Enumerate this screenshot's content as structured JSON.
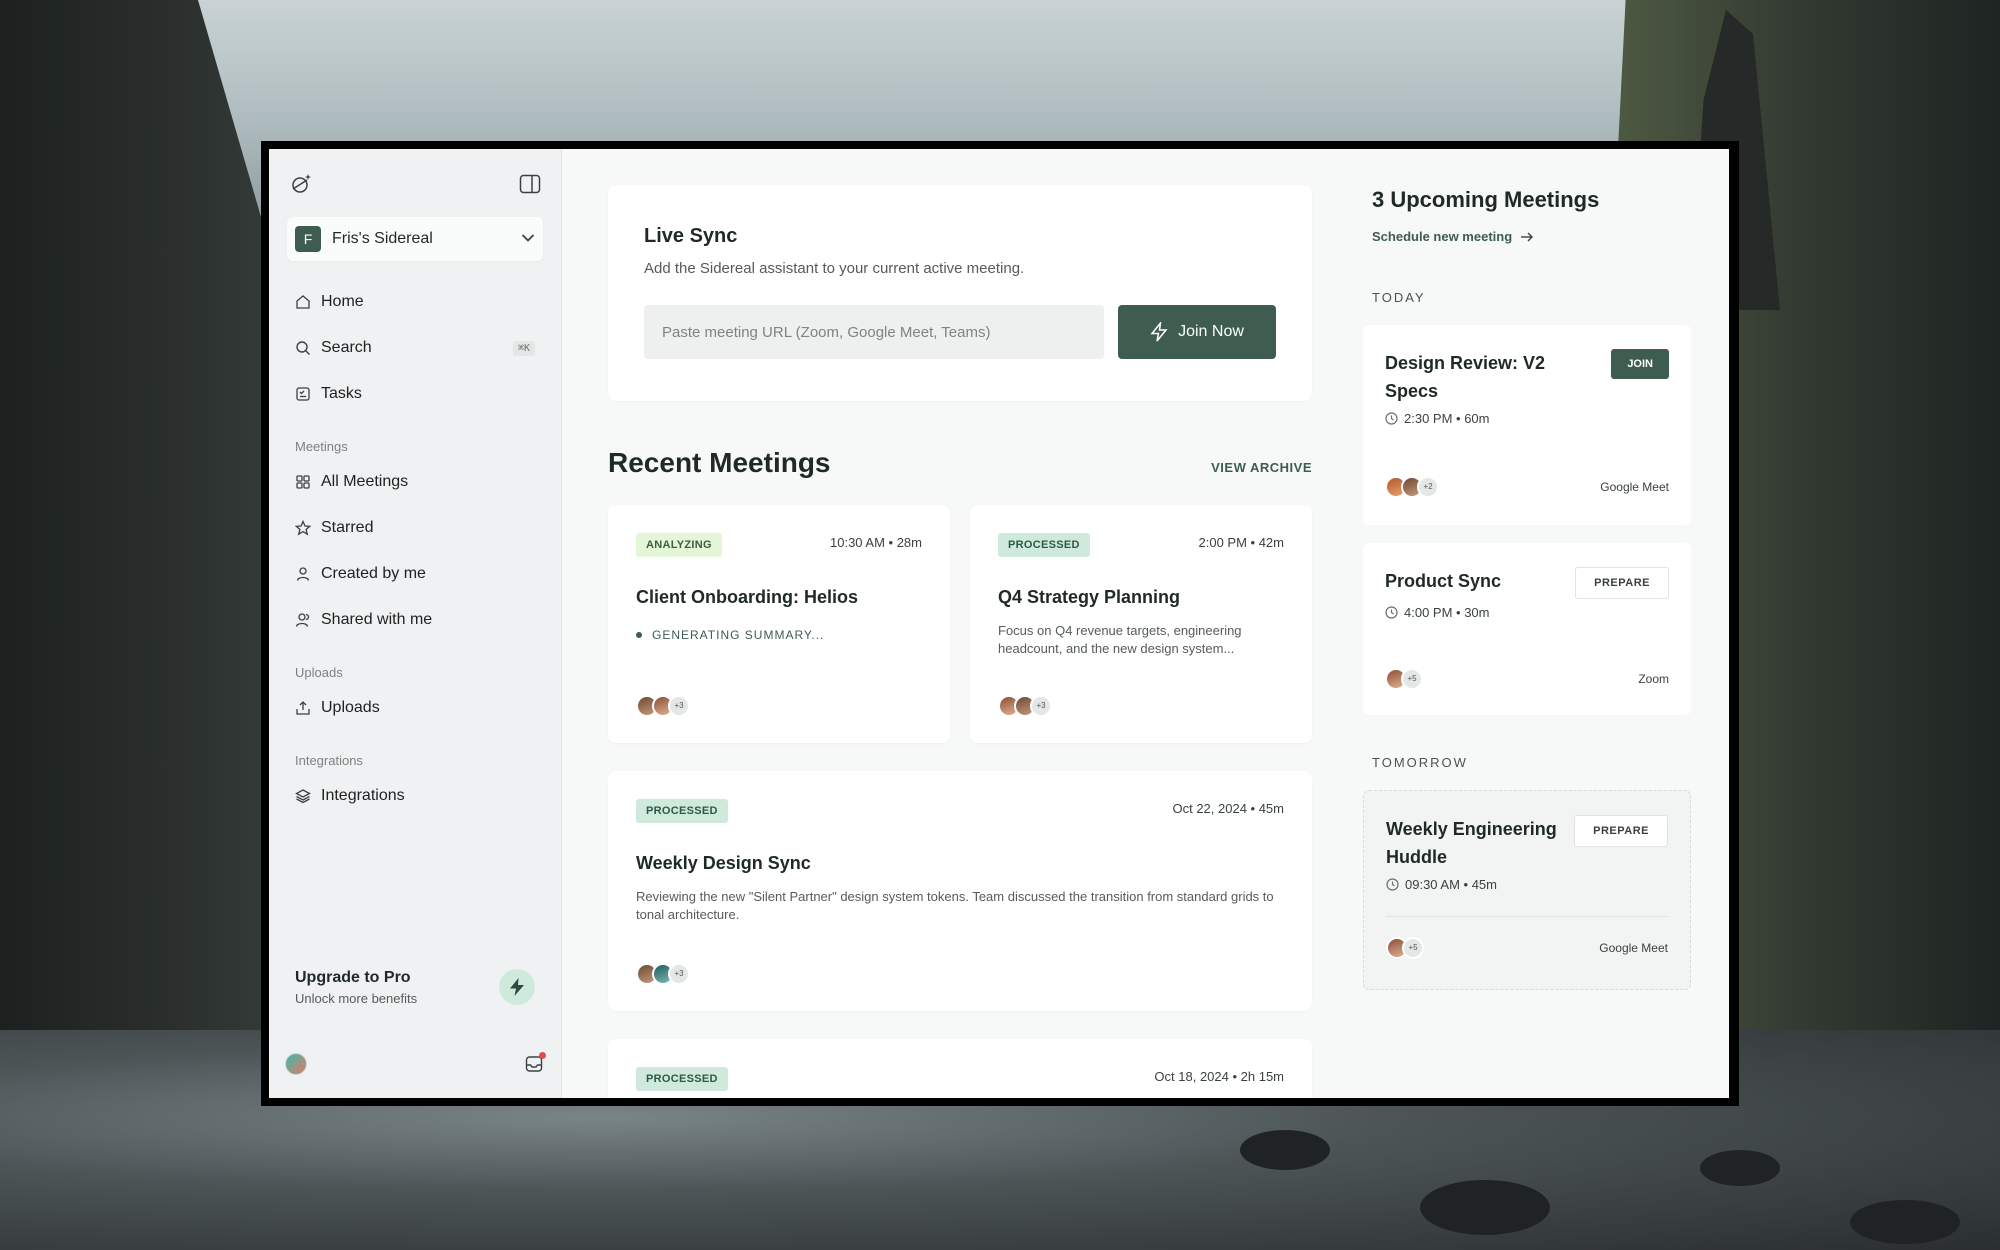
{
  "workspace": {
    "initial": "F",
    "name": "Fris's Sidereal"
  },
  "nav": {
    "home": "Home",
    "search": "Search",
    "search_shortcut": "⌘K",
    "tasks": "Tasks"
  },
  "sections": {
    "meetings": {
      "label": "Meetings",
      "items": [
        "All Meetings",
        "Starred",
        "Created by me",
        "Shared with me"
      ]
    },
    "uploads": {
      "label": "Uploads",
      "items": [
        "Uploads"
      ]
    },
    "integrations": {
      "label": "Integrations",
      "items": [
        "Integrations"
      ]
    }
  },
  "upgrade": {
    "title": "Upgrade to Pro",
    "subtitle": "Unlock more benefits"
  },
  "live_sync": {
    "title": "Live Sync",
    "subtitle": "Add the Sidereal assistant to your current active meeting.",
    "placeholder": "Paste meeting URL (Zoom, Google Meet, Teams)",
    "button": "Join Now"
  },
  "recent": {
    "title": "Recent Meetings",
    "archive": "VIEW ARCHIVE",
    "cards": [
      {
        "status": "ANALYZING",
        "time": "10:30 AM • 28m",
        "title": "Client Onboarding: Helios",
        "note": "GENERATING SUMMARY...",
        "more": "+3"
      },
      {
        "status": "PROCESSED",
        "time": "2:00 PM • 42m",
        "title": "Q4 Strategy Planning",
        "desc": "Focus on Q4 revenue targets, engineering headcount, and the new design system...",
        "more": "+3"
      },
      {
        "status": "PROCESSED",
        "time": "Oct 22, 2024 • 45m",
        "title": "Weekly Design Sync",
        "desc": "Reviewing the new \"Silent Partner\" design system tokens. Team discussed the transition from standard grids to tonal architecture.",
        "more": "+3"
      },
      {
        "status": "PROCESSED",
        "time": "Oct 18, 2024 • 2h 15m"
      }
    ]
  },
  "upcoming": {
    "title": "3 Upcoming Meetings",
    "schedule": "Schedule new meeting",
    "today_label": "TODAY",
    "tomorrow_label": "TOMORROW",
    "meetings": [
      {
        "title": "Design Review: V2 Specs",
        "action": "JOIN",
        "time": "2:30 PM • 60m",
        "more": "+2",
        "platform": "Google Meet"
      },
      {
        "title": "Product Sync",
        "action": "PREPARE",
        "time": "4:00 PM • 30m",
        "more": "+5",
        "platform": "Zoom"
      },
      {
        "title": "Weekly Engineering Huddle",
        "action": "PREPARE",
        "time": "09:30 AM • 45m",
        "more": "+5",
        "platform": "Google Meet"
      }
    ]
  },
  "colors": {
    "accent": "#3e5c50",
    "analyzing_bg": "#e3f7d8",
    "processed_bg": "#cfeadc",
    "notification": "#e24c4c"
  }
}
